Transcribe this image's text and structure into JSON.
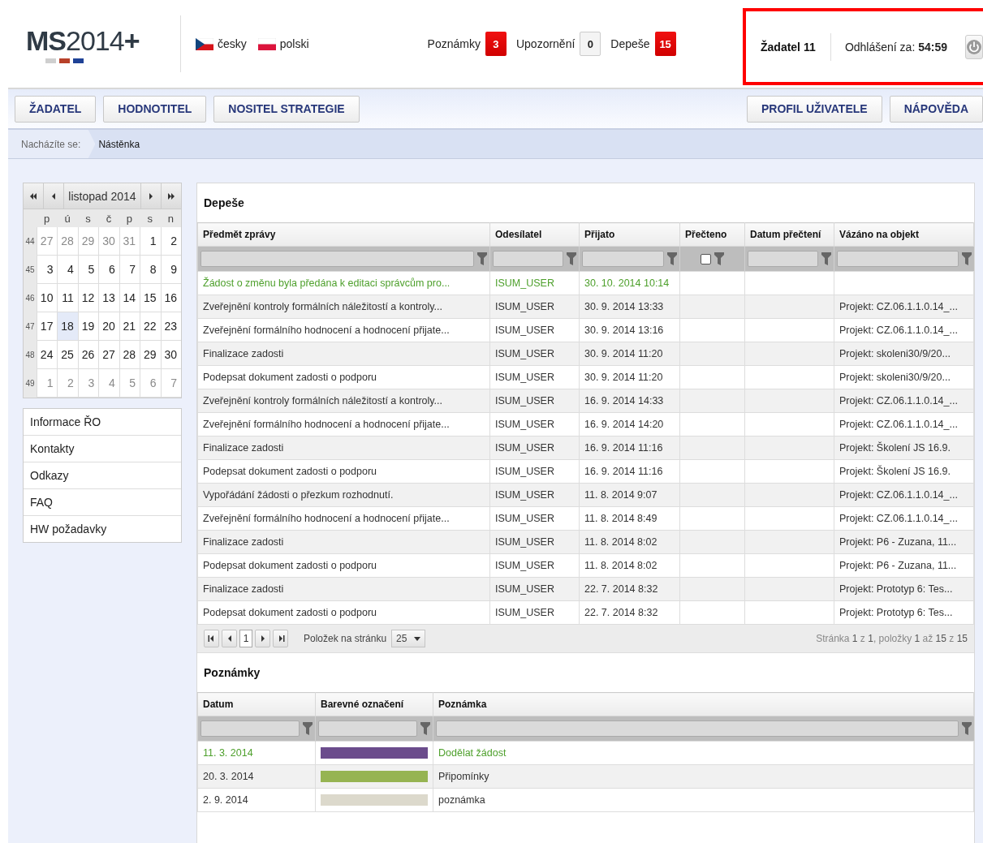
{
  "header": {
    "logo": "**MS**2014**+**",
    "languages": [
      {
        "label": "česky",
        "kind": "cz"
      },
      {
        "label": "polski",
        "kind": "pl"
      }
    ],
    "counters": [
      {
        "label": "Poznámky",
        "count": "3",
        "alert": true
      },
      {
        "label": "Upozornění",
        "count": "0",
        "alert": false
      },
      {
        "label": "Depeše",
        "count": "15",
        "alert": true
      }
    ],
    "user": {
      "name": "Žadatel 11",
      "logout_label": "Odhlášení za:",
      "logout_time": "54:59"
    }
  },
  "nav": {
    "left": [
      "ŽADATEL",
      "HODNOTITEL",
      "NOSITEL STRATEGIE"
    ],
    "right": [
      "PROFIL UŽIVATELE",
      "NÁPOVĚDA"
    ]
  },
  "breadcrumb": {
    "label": "Nacházíte se:",
    "current": "Nástěnka"
  },
  "calendar": {
    "title": "listopad 2014",
    "weekdays": [
      "p",
      "ú",
      "s",
      "č",
      "p",
      "s",
      "n"
    ],
    "weeks": [
      {
        "number": "44",
        "days": [
          {
            "day": "27",
            "other_month": true,
            "selected": false
          },
          {
            "day": "28",
            "other_month": true,
            "selected": false
          },
          {
            "day": "29",
            "other_month": true,
            "selected": false
          },
          {
            "day": "30",
            "other_month": true,
            "selected": false
          },
          {
            "day": "31",
            "other_month": true,
            "selected": false
          },
          {
            "day": "1",
            "other_month": false,
            "selected": false
          },
          {
            "day": "2",
            "other_month": false,
            "selected": false
          }
        ]
      },
      {
        "number": "45",
        "days": [
          {
            "day": "3",
            "other_month": false,
            "selected": false
          },
          {
            "day": "4",
            "other_month": false,
            "selected": false
          },
          {
            "day": "5",
            "other_month": false,
            "selected": false
          },
          {
            "day": "6",
            "other_month": false,
            "selected": false
          },
          {
            "day": "7",
            "other_month": false,
            "selected": false
          },
          {
            "day": "8",
            "other_month": false,
            "selected": false
          },
          {
            "day": "9",
            "other_month": false,
            "selected": false
          }
        ]
      },
      {
        "number": "46",
        "days": [
          {
            "day": "10",
            "other_month": false,
            "selected": false
          },
          {
            "day": "11",
            "other_month": false,
            "selected": false
          },
          {
            "day": "12",
            "other_month": false,
            "selected": false
          },
          {
            "day": "13",
            "other_month": false,
            "selected": false
          },
          {
            "day": "14",
            "other_month": false,
            "selected": false
          },
          {
            "day": "15",
            "other_month": false,
            "selected": false
          },
          {
            "day": "16",
            "other_month": false,
            "selected": false
          }
        ]
      },
      {
        "number": "47",
        "days": [
          {
            "day": "17",
            "other_month": false,
            "selected": false
          },
          {
            "day": "18",
            "other_month": false,
            "selected": true
          },
          {
            "day": "19",
            "other_month": false,
            "selected": false
          },
          {
            "day": "20",
            "other_month": false,
            "selected": false
          },
          {
            "day": "21",
            "other_month": false,
            "selected": false
          },
          {
            "day": "22",
            "other_month": false,
            "selected": false
          },
          {
            "day": "23",
            "other_month": false,
            "selected": false
          }
        ]
      },
      {
        "number": "48",
        "days": [
          {
            "day": "24",
            "other_month": false,
            "selected": false
          },
          {
            "day": "25",
            "other_month": false,
            "selected": false
          },
          {
            "day": "26",
            "other_month": false,
            "selected": false
          },
          {
            "day": "27",
            "other_month": false,
            "selected": false
          },
          {
            "day": "28",
            "other_month": false,
            "selected": false
          },
          {
            "day": "29",
            "other_month": false,
            "selected": false
          },
          {
            "day": "30",
            "other_month": false,
            "selected": false
          }
        ]
      },
      {
        "number": "49",
        "days": [
          {
            "day": "1",
            "other_month": true,
            "selected": false
          },
          {
            "day": "2",
            "other_month": true,
            "selected": false
          },
          {
            "day": "3",
            "other_month": true,
            "selected": false
          },
          {
            "day": "4",
            "other_month": true,
            "selected": false
          },
          {
            "day": "5",
            "other_month": true,
            "selected": false
          },
          {
            "day": "6",
            "other_month": true,
            "selected": false
          },
          {
            "day": "7",
            "other_month": true,
            "selected": false
          }
        ]
      }
    ]
  },
  "links": [
    "Informace ŘO",
    "Kontakty",
    "Odkazy",
    "FAQ",
    "HW požadavky"
  ],
  "messages": {
    "title": "Depeše",
    "columns": [
      {
        "label": "Předmět zprávy",
        "kind": "text"
      },
      {
        "label": "Odesílatel",
        "kind": "text"
      },
      {
        "label": "Přijato",
        "kind": "text"
      },
      {
        "label": "Přečteno",
        "kind": "checkbox",
        "checked": false
      },
      {
        "label": "Datum přečtení",
        "kind": "text"
      },
      {
        "label": "Vázáno na objekt",
        "kind": "text"
      }
    ],
    "rows": [
      {
        "subject": "Žádost o změnu byla předána k editaci správcům pro...",
        "sender": "ISUM_USER",
        "received": "30. 10. 2014 10:14",
        "new": true
      },
      {
        "subject": "Zveřejnění kontroly formálních náležitostí a kontroly...",
        "sender": "ISUM_USER",
        "received": "30. 9. 2014 13:33",
        "object": "Projekt: CZ.06.1.1.0.14_...",
        "new": false
      },
      {
        "subject": "Zveřejnění formálního hodnocení a hodnocení přijate...",
        "sender": "ISUM_USER",
        "received": "30. 9. 2014 13:16",
        "object": "Projekt: CZ.06.1.1.0.14_...",
        "new": false
      },
      {
        "subject": "Finalizace zadosti",
        "sender": "ISUM_USER",
        "received": "30. 9. 2014 11:20",
        "object": "Projekt: skoleni30/9/20...",
        "new": false
      },
      {
        "subject": "Podepsat dokument zadosti o podporu",
        "sender": "ISUM_USER",
        "received": "30. 9. 2014 11:20",
        "object": "Projekt: skoleni30/9/20...",
        "new": false
      },
      {
        "subject": "Zveřejnění kontroly formálních náležitostí a kontroly...",
        "sender": "ISUM_USER",
        "received": "16. 9. 2014 14:33",
        "object": "Projekt: CZ.06.1.1.0.14_...",
        "new": false
      },
      {
        "subject": "Zveřejnění formálního hodnocení a hodnocení přijate...",
        "sender": "ISUM_USER",
        "received": "16. 9. 2014 14:20",
        "object": "Projekt: CZ.06.1.1.0.14_...",
        "new": false
      },
      {
        "subject": "Finalizace zadosti",
        "sender": "ISUM_USER",
        "received": "16. 9. 2014 11:16",
        "object": "Projekt: Školení JS 16.9.",
        "new": false
      },
      {
        "subject": "Podepsat dokument zadosti o podporu",
        "sender": "ISUM_USER",
        "received": "16. 9. 2014 11:16",
        "object": "Projekt: Školení JS 16.9.",
        "new": false
      },
      {
        "subject": "Vypořádání žádosti o přezkum rozhodnutí.",
        "sender": "ISUM_USER",
        "received": "11. 8. 2014 9:07",
        "object": "Projekt: CZ.06.1.1.0.14_...",
        "new": false
      },
      {
        "subject": "Zveřejnění formálního hodnocení a hodnocení přijate...",
        "sender": "ISUM_USER",
        "received": "11. 8. 2014 8:49",
        "object": "Projekt: CZ.06.1.1.0.14_...",
        "new": false
      },
      {
        "subject": "Finalizace zadosti",
        "sender": "ISUM_USER",
        "received": "11. 8. 2014 8:02",
        "object": "Projekt: P6 - Zuzana, 11...",
        "new": false
      },
      {
        "subject": "Podepsat dokument zadosti o podporu",
        "sender": "ISUM_USER",
        "received": "11. 8. 2014 8:02",
        "object": "Projekt: P6 - Zuzana, 11...",
        "new": false
      },
      {
        "subject": "Finalizace zadosti",
        "sender": "ISUM_USER",
        "received": "22. 7. 2014 8:32",
        "object": "Projekt: Prototyp 6: Tes...",
        "new": false
      },
      {
        "subject": "Podepsat dokument zadosti o podporu",
        "sender": "ISUM_USER",
        "received": "22. 7. 2014 8:32",
        "object": "Projekt: Prototyp 6: Tes...",
        "new": false
      }
    ],
    "pager": {
      "page": "1",
      "per_page_label": "Položek na stránku",
      "per_page": "25",
      "summary": "Stránka **1** z **1**, položky **1** až **15** z **15**"
    }
  },
  "notes": {
    "title": "Poznámky",
    "columns": [
      "Datum",
      "Barevné označení",
      "Poznámka"
    ],
    "rows": [
      {
        "date": "11. 3. 2014",
        "color": "#6b4c8c",
        "note": "Dodělat žádost",
        "new": true
      },
      {
        "date": "20. 3. 2014",
        "color": "#96b452",
        "note": "Připomínky",
        "new": false
      },
      {
        "date": "2. 9. 2014",
        "color": "#dcd9cc",
        "note": "poznámka",
        "new": false
      }
    ]
  }
}
